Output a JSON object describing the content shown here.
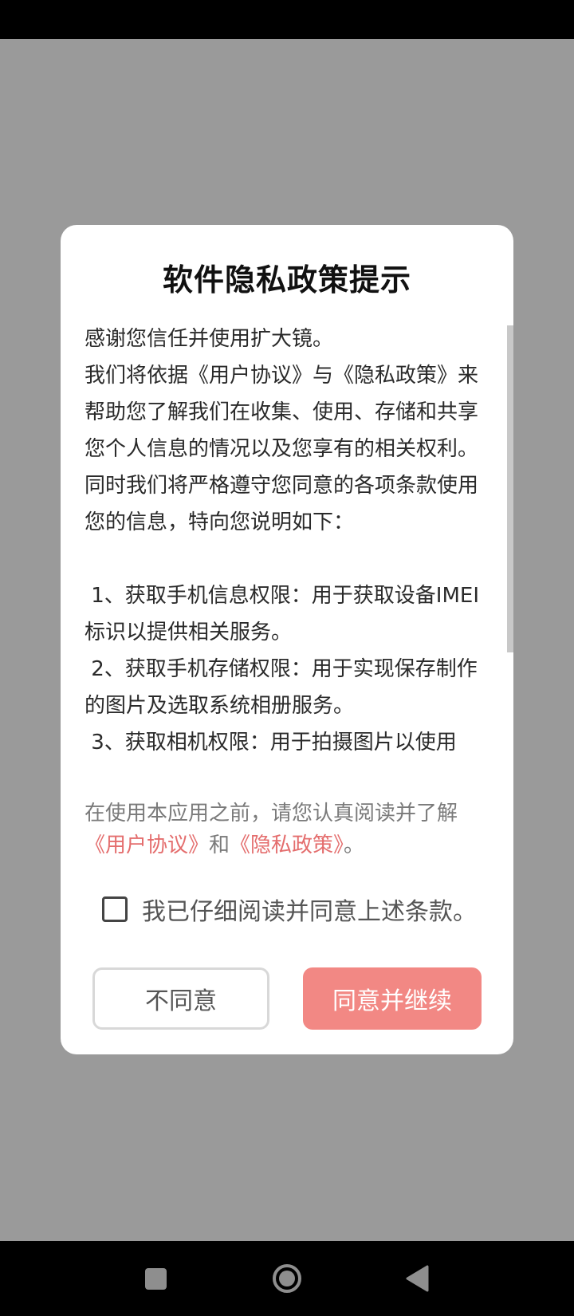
{
  "dialog": {
    "title": "软件隐私政策提示",
    "content": "感谢您信任并使用扩大镜。\n我们将依据《用户协议》与《隐私政策》来帮助您了解我们在收集、使用、存储和共享您个人信息的情况以及您享有的相关权利。\n同时我们将严格遵守您同意的各项条款使用您的信息，特向您说明如下：\n\n 1、获取手机信息权限：用于获取设备IMEI标识以提供相关服务。\n 2、获取手机存储权限：用于实现保存制作的图片及选取系统相册服务。\n 3、获取相机权限：用于拍摄图片以使用",
    "notice_prefix": "在使用本应用之前，请您认真阅读并了解",
    "user_agreement_link": "《用户协议》",
    "notice_and": "和",
    "privacy_policy_link": "《隐私政策》",
    "notice_suffix": "。",
    "agree_checkbox_label": "我已仔细阅读并同意上述条款。",
    "agree_checked": false,
    "decline_button": "不同意",
    "accept_button": "同意并继续"
  },
  "navigation": {
    "recent_icon": "square-icon",
    "home_icon": "circle-home-icon",
    "back_icon": "triangle-back-icon"
  },
  "colors": {
    "overlay": "#9a9a9a",
    "accent": "#f28884",
    "link": "#e46d6d"
  }
}
